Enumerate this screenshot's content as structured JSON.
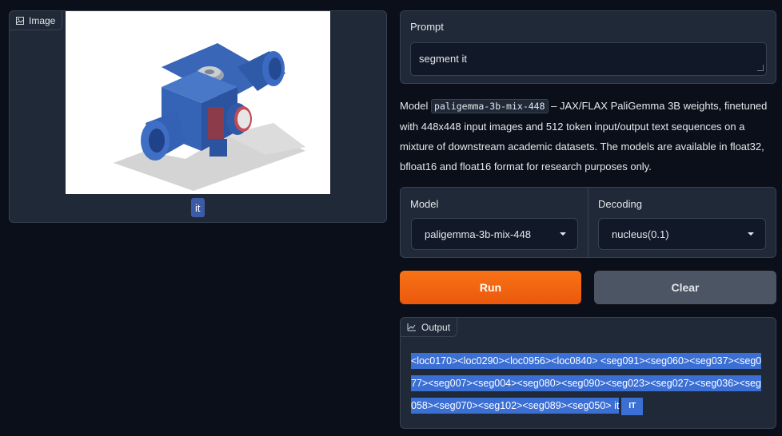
{
  "image_panel": {
    "tag_label": "Image",
    "icon": "image-icon",
    "detected_label": "it"
  },
  "prompt": {
    "label": "Prompt",
    "value": "segment it"
  },
  "description": {
    "prefix": "Model",
    "model_code": "paligemma-3b-mix-448",
    "text": " – JAX/FLAX PaliGemma 3B weights, finetuned with 448x448 input images and 512 token input/output text sequences on a mixture of downstream academic datasets. The models are available in float32, bfloat16 and float16 format for research purposes only."
  },
  "settings": {
    "model_label": "Model",
    "model_value": "paligemma-3b-mix-448",
    "decoding_label": "Decoding",
    "decoding_value": "nucleus(0.1)"
  },
  "buttons": {
    "run": "Run",
    "clear": "Clear"
  },
  "output": {
    "tag_label": "Output",
    "icon": "chart-icon",
    "text": "<loc0170><loc0290><loc0956><loc0840> <seg091><seg060><seg037><seg077><seg007><seg004><seg080><seg090><seg023><seg027><seg036><seg058><seg070><seg102><seg089><seg050> it",
    "badge": "IT"
  },
  "colors": {
    "background": "#0b0f19",
    "panel": "#1f2937",
    "accent_orange": "#f97316",
    "highlight_blue": "#3b6fd4"
  }
}
